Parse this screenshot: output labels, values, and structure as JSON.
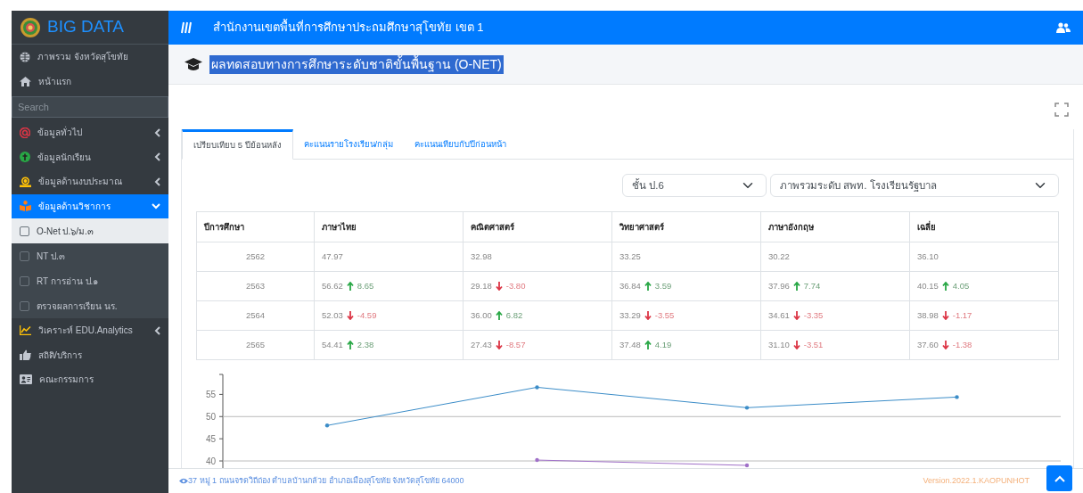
{
  "sidebar": {
    "brand": "BIG DATA",
    "search": {
      "placeholder": "Search"
    },
    "items": [
      {
        "label": "ภาพรวม จังหวัดสุโขทัย",
        "kind": "link"
      },
      {
        "label": "หน้าแรก",
        "kind": "link"
      },
      {
        "label": "ข้อมูลทั่วไป",
        "kind": "group",
        "expanded": false
      },
      {
        "label": "ข้อมูลนักเรียน",
        "kind": "group",
        "expanded": false
      },
      {
        "label": "ข้อมูลด้านงบประมาณ",
        "kind": "group",
        "expanded": false
      },
      {
        "label": "ข้อมูลด้านวิชาการ",
        "kind": "group",
        "expanded": true,
        "children": [
          {
            "label": "O-Net ป.๖/ม.๓",
            "selected": true
          },
          {
            "label": "NT ป.๓",
            "selected": false
          },
          {
            "label": "RT การอ่าน ป.๑",
            "selected": false
          },
          {
            "label": "ตรวจผลการเรียน นร.",
            "selected": false
          }
        ]
      },
      {
        "label": "วิเคราะห์ EDU.Analytics",
        "kind": "group",
        "expanded": false
      },
      {
        "label": "สถิติ/บริการ",
        "kind": "link"
      },
      {
        "label": "คณะกรรมการ",
        "kind": "link"
      }
    ]
  },
  "header": {
    "title": "สำนักงานเขตพื้นที่การศึกษาประถมศึกษาสุโขทัย เขต 1"
  },
  "page_title": "ผลทดสอบทางการศึกษาระดับชาติขั้นพื้นฐาน (O-NET)",
  "tabs": [
    {
      "label": "เปรียบเทียบ 5 ปีย้อนหลัง",
      "selected": true
    },
    {
      "label": "คะแนนรายโรงเรียน/กลุ่ม",
      "selected": false
    },
    {
      "label": "คะแนนเทียบกับปีก่อนหน้า",
      "selected": false
    }
  ],
  "filters": [
    {
      "value": "ชั้น ป.6"
    },
    {
      "value": "ภาพรวมระดับ สพท. โรงเรียนรัฐบาล"
    }
  ],
  "table": {
    "columns": [
      "ปีการศึกษา",
      "ภาษาไทย",
      "คณิตศาสตร์",
      "วิทยาศาสตร์",
      "ภาษาอังกฤษ",
      "เฉลี่ย"
    ],
    "rows": [
      [
        {
          "score": "2562"
        },
        {
          "score": "47.97"
        },
        {
          "score": "32.98"
        },
        {
          "score": "33.25"
        },
        {
          "score": "30.22"
        },
        {
          "score": "36.10"
        }
      ],
      [
        {
          "score": "2563"
        },
        {
          "score": "56.62",
          "increase": true,
          "change": "8.65"
        },
        {
          "score": "29.18",
          "increase": false,
          "change": "-3.80"
        },
        {
          "score": "36.84",
          "increase": true,
          "change": "3.59"
        },
        {
          "score": "37.96",
          "increase": true,
          "change": "7.74"
        },
        {
          "score": "40.15",
          "increase": true,
          "change": "4.05"
        }
      ],
      [
        {
          "score": "2564"
        },
        {
          "score": "52.03",
          "increase": false,
          "change": "-4.59"
        },
        {
          "score": "36.00",
          "increase": true,
          "change": "6.82"
        },
        {
          "score": "33.29",
          "increase": false,
          "change": "-3.55"
        },
        {
          "score": "34.61",
          "increase": false,
          "change": "-3.35"
        },
        {
          "score": "38.98",
          "increase": false,
          "change": "-1.17"
        }
      ],
      [
        {
          "score": "2565"
        },
        {
          "score": "54.41",
          "increase": true,
          "change": "2.38"
        },
        {
          "score": "27.43",
          "increase": false,
          "change": "-8.57"
        },
        {
          "score": "37.48",
          "increase": true,
          "change": "4.19"
        },
        {
          "score": "31.10",
          "increase": false,
          "change": "-3.51"
        },
        {
          "score": "37.60",
          "increase": false,
          "change": "-1.38"
        }
      ]
    ]
  },
  "chart_data": {
    "type": "line",
    "ylim": [
      38,
      59.5
    ],
    "yticks": [
      40,
      45,
      50,
      55
    ],
    "series": [
      {
        "color": "#3c8dc8",
        "values": [
          48.0,
          56.6,
          52.0,
          54.4
        ]
      },
      {
        "color": "#a070c8",
        "values": [
          null,
          40.2,
          39.0,
          null
        ]
      }
    ]
  },
  "footer": {
    "address": "37 หมู่ 1 ถนนจรดวิถีถ่อง ตำบลบ้านกล้วย อำเภอเมืองสุโขทัย จังหวัดสุโขทัย 64000",
    "version": "Version.2022.1.KAOPUNHOT"
  }
}
